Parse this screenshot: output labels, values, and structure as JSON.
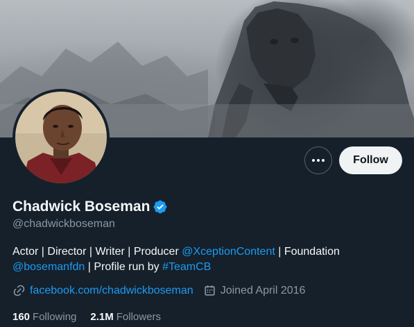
{
  "profile": {
    "display_name": "Chadwick Boseman",
    "handle": "@chadwickboseman",
    "verified": true,
    "bio": {
      "text1": "Actor | Director | Writer | Producer ",
      "mention1": "@XceptionContent",
      "text2": " | Foundation",
      "mention2": "@bosemanfdn",
      "text3": " | Profile run by ",
      "hashtag": "#TeamCB"
    },
    "website": "facebook.com/chadwickboseman",
    "joined": "Joined April 2016",
    "following_count": "160",
    "following_label": "Following",
    "followers_count": "2.1M",
    "followers_label": "Followers"
  },
  "actions": {
    "follow_label": "Follow"
  },
  "icons": {
    "more": "more-horizontal-icon",
    "verified": "verified-badge-icon",
    "link": "link-icon",
    "calendar": "calendar-icon"
  },
  "colors": {
    "background": "#15202b",
    "accent": "#1d9bf0",
    "secondary_text": "#8b98a5",
    "primary_text": "#f7f9f9",
    "follow_button_bg": "#eff3f4"
  }
}
